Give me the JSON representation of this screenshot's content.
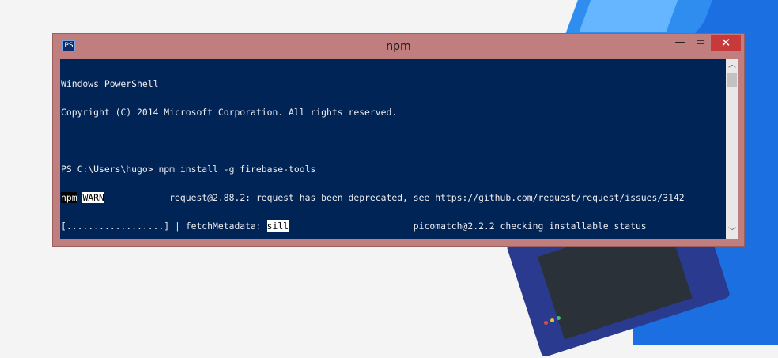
{
  "window": {
    "title": "npm",
    "icon_label": "PS",
    "controls": {
      "minimize": "—",
      "maximize": "▭",
      "close": "✕"
    }
  },
  "console": {
    "lines": [
      "Windows PowerShell",
      "Copyright (C) 2014 Microsoft Corporation. All rights reserved.",
      "",
      "PS C:\\Users\\hugo> npm install -g firebase-tools"
    ],
    "warn_line": {
      "prefix": "npm",
      "level": "WARN",
      "message": "            request@2.88.2: request has been deprecated, see https://github.com/request/request/issues/3142"
    },
    "progress_line": {
      "bar": "[..................] | fetchMetadata: ",
      "level": "sill",
      "message": "                       picomatch@2.2.2 checking installable status"
    }
  },
  "scrollbar": {
    "up": "︿",
    "down": "﹀"
  }
}
